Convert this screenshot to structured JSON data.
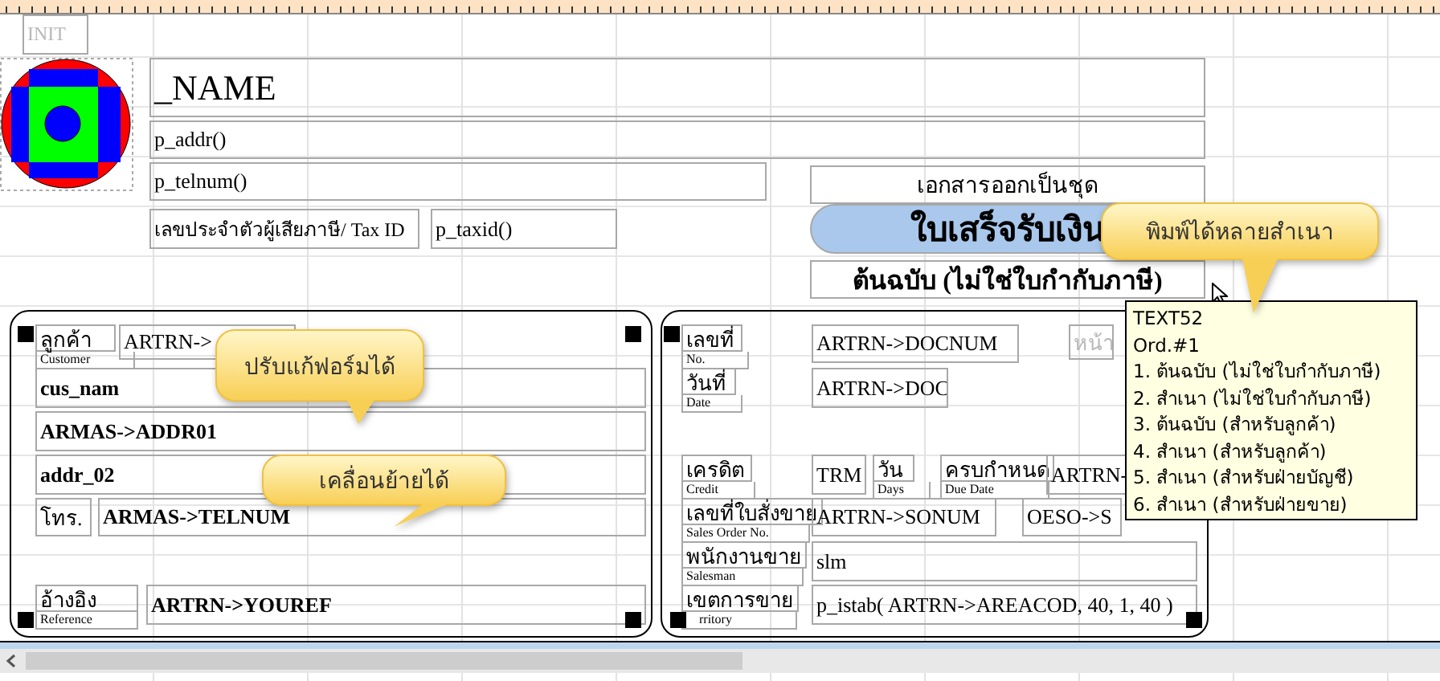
{
  "init_label": "INIT",
  "company": {
    "name": "_NAME",
    "address": "p_addr()",
    "phone": "p_telnum()",
    "tax_label": "เลขประจำตัวผู้เสียภาษี/ Tax ID",
    "tax_value": "p_taxid()"
  },
  "document": {
    "set_label": "เอกสารออกเป็นชุด",
    "title": "ใบเสร็จรับเงิน",
    "copy": "ต้นฉบับ (ไม่ใช่ใบกำกับภาษี)"
  },
  "customer_panel": {
    "items": [
      {
        "kind": "caption",
        "label": "ลูกค้า",
        "sublabel": "Customer"
      },
      {
        "kind": "field",
        "value": "ARTRN->"
      },
      {
        "kind": "bold_field",
        "value": "cus_nam"
      },
      {
        "kind": "bold_field",
        "value": "ARMAS->ADDR01"
      },
      {
        "kind": "bold_field",
        "value": "addr_02"
      },
      {
        "kind": "field",
        "value": "โทร."
      },
      {
        "kind": "bold_field",
        "value": "ARMAS->TELNUM"
      },
      {
        "kind": "caption",
        "label": "อ้างอิง",
        "sublabel": "Reference"
      },
      {
        "kind": "bold_field",
        "value": "ARTRN->YOUREF"
      }
    ]
  },
  "document_panel": {
    "items": [
      {
        "kind": "caption",
        "label": "เลขที่",
        "sublabel": "No."
      },
      {
        "kind": "field",
        "value": "ARTRN->DOCNUM"
      },
      {
        "kind": "faint_field",
        "value": "หน้า"
      },
      {
        "kind": "caption",
        "label": "วันที่",
        "sublabel": "Date"
      },
      {
        "kind": "field",
        "value": "ARTRN->DOC"
      },
      {
        "kind": "caption",
        "label": "เครดิต",
        "sublabel": "Credit"
      },
      {
        "kind": "field",
        "value": "TRM"
      },
      {
        "kind": "caption",
        "label": "วัน",
        "sublabel": "Days"
      },
      {
        "kind": "caption",
        "label": "ครบกำหนด",
        "sublabel": "Due Date"
      },
      {
        "kind": "field",
        "value": "ARTRN-"
      },
      {
        "kind": "caption",
        "label": "เลขที่ใบสั่งขาย",
        "sublabel": "Sales Order No."
      },
      {
        "kind": "field",
        "value": "ARTRN->SONUM"
      },
      {
        "kind": "field",
        "value": "OESO->S"
      },
      {
        "kind": "caption",
        "label": "พนักงานขาย",
        "sublabel": "Salesman"
      },
      {
        "kind": "field",
        "value": "slm"
      },
      {
        "kind": "caption",
        "label": "เขตการขาย",
        "sublabel": "rritory"
      },
      {
        "kind": "field",
        "value": "p_istab( ARTRN->AREACOD, 40, 1, 40 )"
      }
    ]
  },
  "callouts": [
    {
      "text": "ปรับแก้ฟอร์มได้"
    },
    {
      "text": "เคลื่อนย้ายได้"
    },
    {
      "text": "พิมพ์ได้หลายสำเนา"
    }
  ],
  "tooltip": {
    "lines": [
      "TEXT52",
      "Ord.#1",
      "1. ต้นฉบับ (ไม่ใช่ใบกำกับภาษี)",
      "2. สำเนา (ไม่ใช่ใบกำกับภาษี)",
      "3. ต้นฉบับ (สำหรับลูกค้า)",
      "4. สำเนา (สำหรับลูกค้า)",
      "5. สำเนา (สำหรับฝ่ายบัญชี)",
      "6. สำเนา (สำหรับฝ่ายขาย)"
    ]
  }
}
